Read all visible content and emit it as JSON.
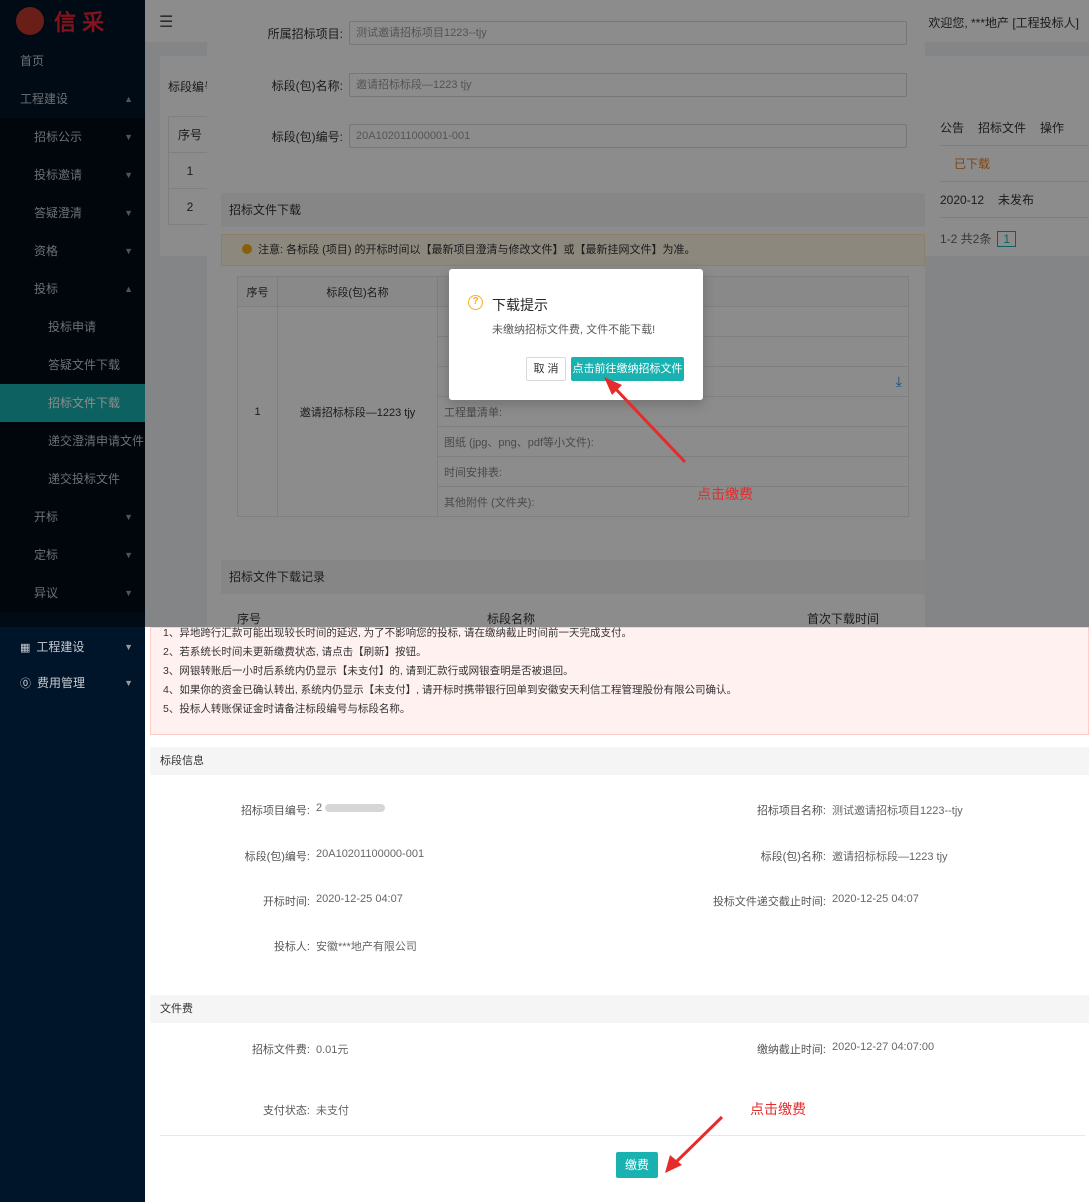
{
  "top": {
    "logo": "信 采",
    "header": {
      "fold_icon": "menu-fold-icon",
      "welcome": "欢迎您, ***地产 [工程投标人]"
    },
    "sidebar": [
      {
        "label": "首页",
        "level": 0
      },
      {
        "label": "工程建设",
        "level": 0,
        "arrow": "▲"
      },
      {
        "label": "招标公示",
        "level": 1,
        "arrow": "▼"
      },
      {
        "label": "投标邀请",
        "level": 1,
        "arrow": "▼"
      },
      {
        "label": "答疑澄清",
        "level": 1,
        "arrow": "▼"
      },
      {
        "label": "资格",
        "level": 1,
        "arrow": "▼"
      },
      {
        "label": "投标",
        "level": 1,
        "arrow": "▲"
      },
      {
        "label": "投标申请",
        "level": 2
      },
      {
        "label": "答疑文件下载",
        "level": 2
      },
      {
        "label": "招标文件下载",
        "level": 2,
        "active": true
      },
      {
        "label": "递交澄清申请文件",
        "level": 2
      },
      {
        "label": "递交投标文件",
        "level": 2
      },
      {
        "label": "开标",
        "level": 1,
        "arrow": "▼"
      },
      {
        "label": "定标",
        "level": 1,
        "arrow": "▼"
      },
      {
        "label": "异议",
        "level": 1,
        "arrow": "▼"
      }
    ],
    "bg": {
      "label": "标段编号",
      "col_no": "序号",
      "rows": [
        "1",
        "2"
      ],
      "right_head": [
        "公告",
        "招标文件",
        "操作"
      ],
      "right_row1": [
        "",
        "已下载"
      ],
      "right_row2": [
        "2020-12",
        "未发布"
      ],
      "pager": "1-2 共2条",
      "page": "1"
    },
    "drawer": {
      "project_label": "所属招标项目:",
      "project_value": "测试邀请招标项目1223--tjy",
      "section_name_label": "标段(包)名称:",
      "section_name_value": "邀请招标标段—1223 tjy",
      "section_no_label": "标段(包)编号:",
      "section_no_value": "20A102011000001-001",
      "download_title": "招标文件下载",
      "notice": "注意: 各标段 (项目) 的开标时间以【最新项目澄清与修改文件】或【最新挂网文件】为准。",
      "table_head": [
        "序号",
        "标段(包)名称",
        ""
      ],
      "row_no": "1",
      "row_name": "邀请招标标段—1223 tjy",
      "files": [
        "",
        "",
        "",
        "工程量清单:",
        "图纸 (jpg、png、pdf等小文件):",
        "时间安排表:",
        "其他附件 (文件夹):"
      ],
      "download_icon": "download-icon",
      "log_title": "招标文件下载记录",
      "log_head": [
        "序号",
        "标段名称",
        "首次下载时间"
      ]
    },
    "modal": {
      "icon": "question-circle-icon",
      "title": "下载提示",
      "message": "未缴纳招标文件费, 文件不能下载!",
      "cancel": "取 消",
      "go": "点击前往缴纳招标文件费"
    },
    "annotation": "点击缴费"
  },
  "bottom": {
    "sidebar": [
      {
        "label": "工程建设",
        "icon": "building-icon",
        "arrow": "▼"
      },
      {
        "label": "费用管理",
        "icon": "money-icon",
        "arrow": "▼"
      }
    ],
    "rules": [
      "1、异地跨行汇款可能出现较长时间的延迟, 为了不影响您的投标, 请在缴纳截止时间前一天完成支付。",
      "2、若系统长时间未更新缴费状态, 请点击【刷新】按钮。",
      "3、网银转账后一小时后系统内仍显示【未支付】的, 请到汇款行或网银查明是否被退回。",
      "4、如果你的资金已确认转出, 系统内仍显示【未支付】, 请开标时携带银行回单到安徽安天利信工程管理股份有限公司确认。",
      "5、投标人转账保证金时请备注标段编号与标段名称。"
    ],
    "section_info_title": "标段信息",
    "info": {
      "project_no_label": "招标项目编号:",
      "project_no_value": "2",
      "project_name_label": "招标项目名称:",
      "project_name_value": "测试邀请招标项目1223--tjy",
      "section_no_label": "标段(包)编号:",
      "section_no_value": "20A10201100000-001",
      "section_name_label": "标段(包)名称:",
      "section_name_value": "邀请招标标段—1223 tjy",
      "open_time_label": "开标时间:",
      "open_time_value": "2020-12-25 04:07",
      "deadline_label": "投标文件递交截止时间:",
      "deadline_value": "2020-12-25 04:07",
      "bidder_label": "投标人:",
      "bidder_value": "安徽***地产有限公司"
    },
    "fee_title": "文件费",
    "fee": {
      "fee_label": "招标文件费:",
      "fee_value": "0.01元",
      "pay_deadline_label": "缴纳截止时间:",
      "pay_deadline_value": "2020-12-27 04:07:00",
      "status_label": "支付状态:",
      "status_value": "未支付"
    },
    "annotation": "点击缴费",
    "pay_button": "缴费"
  },
  "colors": {
    "sidebar": "#001529",
    "accent": "#1ab1b1",
    "annotation": "#e62b2b"
  }
}
